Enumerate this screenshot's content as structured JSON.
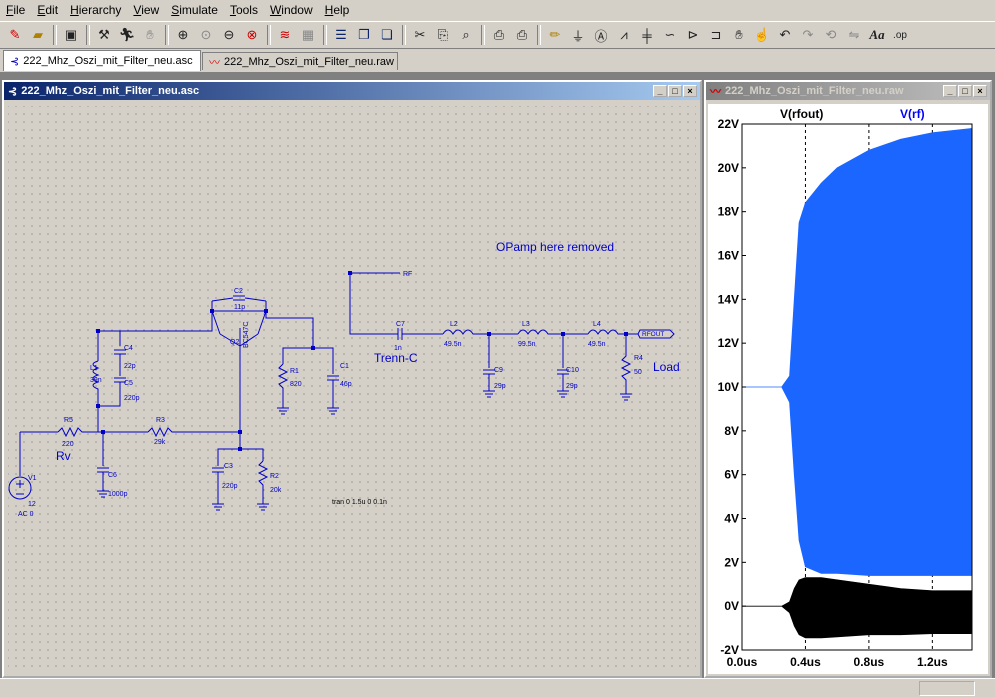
{
  "menu": [
    {
      "key": "F",
      "rest": "ile"
    },
    {
      "key": "E",
      "rest": "dit"
    },
    {
      "key": "H",
      "rest": "ierarchy"
    },
    {
      "key": "V",
      "rest": "iew"
    },
    {
      "key": "S",
      "rest": "imulate"
    },
    {
      "key": "T",
      "rest": "ools"
    },
    {
      "key": "W",
      "rest": "indow"
    },
    {
      "key": "H",
      "rest": "elp"
    }
  ],
  "tabs": [
    {
      "label": "222_Mhz_Oszi_mit_Filter_neu.asc"
    },
    {
      "label": "222_Mhz_Oszi_mit_Filter_neu.raw"
    }
  ],
  "schematic_window": {
    "title": "222_Mhz_Oszi_mit_Filter_neu.asc",
    "comment": "OPamp here removed",
    "labels": {
      "rf": "RF",
      "rv": "Rv",
      "trenn": "Trenn-C",
      "load": "Load",
      "rfout": "RFOUT",
      "tran": "tran 0 1.5u 0 0.1n",
      "ac": "AC 0"
    },
    "components": {
      "c2": {
        "name": "C2",
        "value": "11p"
      },
      "q2": {
        "name": "Q2",
        "value": "BC547C"
      },
      "c4": {
        "name": "C4",
        "value": "22p"
      },
      "l1": {
        "name": "L1",
        "value": "39n"
      },
      "c5": {
        "name": "C5",
        "value": "220p"
      },
      "r1": {
        "name": "R1",
        "value": "820"
      },
      "c1": {
        "name": "C1",
        "value": "46p"
      },
      "r5": {
        "name": "R5",
        "value": "220"
      },
      "r3": {
        "name": "R3",
        "value": "29k"
      },
      "v1": {
        "name": "V1",
        "value": "12"
      },
      "c6": {
        "name": "C6",
        "value": "1000p"
      },
      "c3": {
        "name": "C3",
        "value": "220p"
      },
      "r2": {
        "name": "R2",
        "value": "20k"
      },
      "c7": {
        "name": "C7",
        "value": "1n"
      },
      "l2": {
        "name": "L2",
        "value": "49.5n"
      },
      "l3": {
        "name": "L3",
        "value": "99.5n"
      },
      "l4": {
        "name": "L4",
        "value": "49.5n"
      },
      "c9": {
        "name": "C9",
        "value": "29p"
      },
      "c10": {
        "name": "C10",
        "value": "29p"
      },
      "r4": {
        "name": "R4",
        "value": "50"
      }
    }
  },
  "plot_window": {
    "title": "222_Mhz_Oszi_mit_Filter_neu.raw",
    "trace_labels": {
      "rfout": "V(rfout)",
      "rf": "V(rf)"
    },
    "colors": {
      "rfout": "#000000",
      "rf": "#0000ff",
      "rf_fill": "#1a66ff"
    }
  },
  "chart_data": {
    "type": "line",
    "title": "",
    "xlabel": "",
    "ylabel": "",
    "xlim": [
      0,
      1.45
    ],
    "ylim": [
      -2,
      22
    ],
    "x_ticks": [
      "0.0us",
      "0.4us",
      "0.8us",
      "1.2us"
    ],
    "y_ticks": [
      "-2V",
      "0V",
      "2V",
      "4V",
      "6V",
      "8V",
      "10V",
      "12V",
      "14V",
      "16V",
      "18V",
      "20V",
      "22V"
    ],
    "series": [
      {
        "name": "V(rf)",
        "x_us": [
          0,
          0.25,
          0.3,
          0.33,
          0.36,
          0.4,
          0.5,
          0.6,
          0.8,
          1.0,
          1.2,
          1.45
        ],
        "upper": [
          10,
          10,
          10.5,
          14,
          17.5,
          18.4,
          19.3,
          20.0,
          20.8,
          21.3,
          21.6,
          21.8
        ],
        "lower": [
          10,
          10,
          9.3,
          6,
          3,
          1.8,
          1.5,
          1.5,
          1.4,
          1.4,
          1.4,
          1.4
        ]
      },
      {
        "name": "V(rfout)",
        "x_us": [
          0,
          0.25,
          0.3,
          0.33,
          0.36,
          0.4,
          0.5,
          0.6,
          0.8,
          1.0,
          1.2,
          1.45
        ],
        "upper": [
          0,
          0,
          0.2,
          0.8,
          1.2,
          1.3,
          1.3,
          1.2,
          1.0,
          0.8,
          0.7,
          0.7
        ],
        "lower": [
          0,
          0,
          -0.3,
          -0.9,
          -1.3,
          -1.45,
          -1.45,
          -1.4,
          -1.3,
          -1.3,
          -1.25,
          -1.25
        ]
      }
    ]
  }
}
